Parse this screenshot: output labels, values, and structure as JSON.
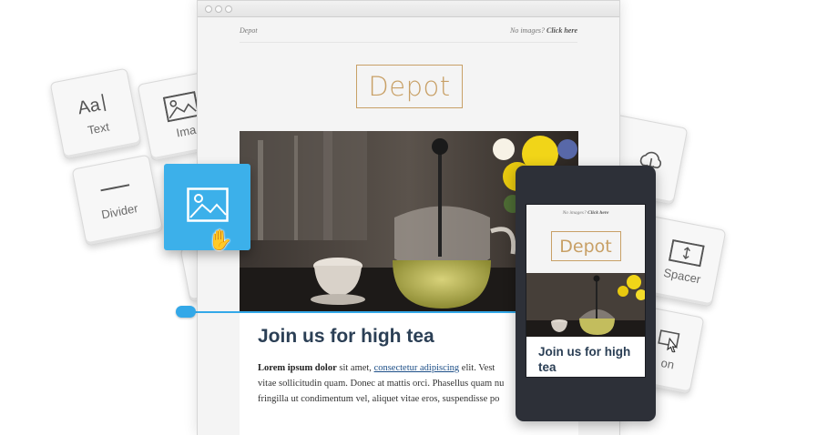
{
  "tiles": {
    "text": "Text",
    "image": "Ima",
    "divider": "Divider",
    "spacer": "Spacer",
    "button": "on"
  },
  "email": {
    "brand_small": "Depot",
    "no_images_prefix": "No images?",
    "no_images_link": "Click here",
    "logo": "Depot",
    "headline": "Join us for high tea",
    "body_bold": "Lorem ipsum dolor",
    "body_after_bold": " sit amet, ",
    "body_link": "consectetur adipiscing",
    "body_after_link": " elit. Vest",
    "body_line2": "vitae sollicitudin quam. Donec at mattis orci. Phasellus quam nu",
    "body_line3": "fringilla ut condimentum vel, aliquet vitae eros, suspendisse po"
  },
  "mobile": {
    "no_images_prefix": "No images?",
    "no_images_link": "Click here",
    "logo": "Depot",
    "headline": "Join us for high tea"
  },
  "icons": [
    "text-icon",
    "image-icon",
    "divider-icon",
    "spacer-icon",
    "button-icon",
    "upload-icon",
    "hand-cursor-icon"
  ],
  "colors": {
    "accent_blue": "#3cb0ea",
    "logo_gold": "#c8a066",
    "headline_navy": "#2b3f55",
    "phone_body": "#2d3038"
  }
}
